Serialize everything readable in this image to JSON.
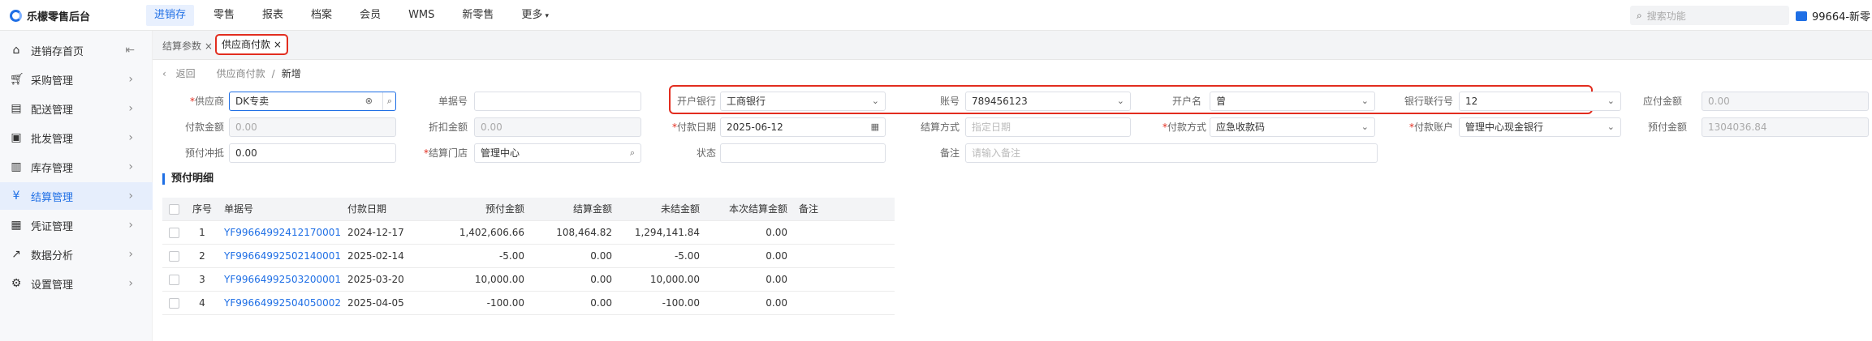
{
  "app": {
    "title": "乐檬零售后台"
  },
  "topnav": [
    "进销存",
    "零售",
    "报表",
    "档案",
    "会员",
    "WMS",
    "新零售",
    "更多"
  ],
  "search": {
    "placeholder": "搜索功能"
  },
  "user": {
    "label": "99664-新零"
  },
  "sidebar": {
    "items": [
      {
        "label": "进销存首页",
        "icon": "home-icon"
      },
      {
        "label": "采购管理",
        "icon": "cart-icon"
      },
      {
        "label": "配送管理",
        "icon": "truck-icon"
      },
      {
        "label": "批发管理",
        "icon": "box-icon"
      },
      {
        "label": "库存管理",
        "icon": "warehouse-icon"
      },
      {
        "label": "结算管理",
        "icon": "money-icon"
      },
      {
        "label": "凭证管理",
        "icon": "document-icon"
      },
      {
        "label": "数据分析",
        "icon": "chart-icon"
      },
      {
        "label": "设置管理",
        "icon": "gear-icon"
      }
    ]
  },
  "tabs": [
    {
      "label": "结算参数"
    },
    {
      "label": "供应商付款"
    }
  ],
  "breadcrumb": {
    "back": "返回",
    "parent": "供应商付款",
    "sep": "/",
    "current": "新增"
  },
  "form": {
    "supplier": {
      "label": "供应商",
      "value": "DK专卖"
    },
    "doc_no": {
      "label": "单据号",
      "value": ""
    },
    "open_bank": {
      "label": "开户银行",
      "value": "工商银行"
    },
    "account_no": {
      "label": "账号",
      "value": "789456123"
    },
    "account_name": {
      "label": "开户名",
      "value": "曾"
    },
    "bank_code": {
      "label": "银行联行号",
      "value": "12"
    },
    "payable": {
      "label": "应付金额",
      "value": "0.00"
    },
    "pay_amount": {
      "label": "付款金额",
      "value": "0.00"
    },
    "discount": {
      "label": "折扣金额",
      "value": "0.00"
    },
    "pay_date": {
      "label": "付款日期",
      "value": "2025-06-12"
    },
    "settle_method": {
      "label": "结算方式",
      "placeholder": "指定日期"
    },
    "pay_method": {
      "label": "付款方式",
      "value": "应急收款码"
    },
    "pay_account": {
      "label": "付款账户",
      "value": "管理中心现金银行"
    },
    "prepaid": {
      "label": "预付金额",
      "value": "1304036.84"
    },
    "prepaid_offset": {
      "label": "预付冲抵",
      "value": "0.00"
    },
    "store": {
      "label": "结算门店",
      "value": "管理中心"
    },
    "status": {
      "label": "状态",
      "value": ""
    },
    "remark": {
      "label": "备注",
      "placeholder": "请输入备注"
    }
  },
  "section": {
    "title": "预付明细"
  },
  "table": {
    "headers": [
      "序号",
      "单据号",
      "付款日期",
      "预付金额",
      "结算金额",
      "未结金额",
      "本次结算金额",
      "备注"
    ],
    "rows": [
      {
        "no": "1",
        "doc": "YF99664992412170001",
        "date": "2024-12-17",
        "prepaid": "1,402,606.66",
        "settled": "108,464.82",
        "unsettled": "1,294,141.84",
        "current": "0.00",
        "remark": ""
      },
      {
        "no": "2",
        "doc": "YF99664992502140001",
        "date": "2025-02-14",
        "prepaid": "-5.00",
        "settled": "0.00",
        "unsettled": "-5.00",
        "current": "0.00",
        "remark": ""
      },
      {
        "no": "3",
        "doc": "YF99664992503200001",
        "date": "2025-03-20",
        "prepaid": "10,000.00",
        "settled": "0.00",
        "unsettled": "10,000.00",
        "current": "0.00",
        "remark": ""
      },
      {
        "no": "4",
        "doc": "YF99664992504050002",
        "date": "2025-04-05",
        "prepaid": "-100.00",
        "settled": "0.00",
        "unsettled": "-100.00",
        "current": "0.00",
        "remark": ""
      }
    ]
  },
  "colors": {
    "accent": "#1f6fe5",
    "highlight": "#e22d1f"
  }
}
